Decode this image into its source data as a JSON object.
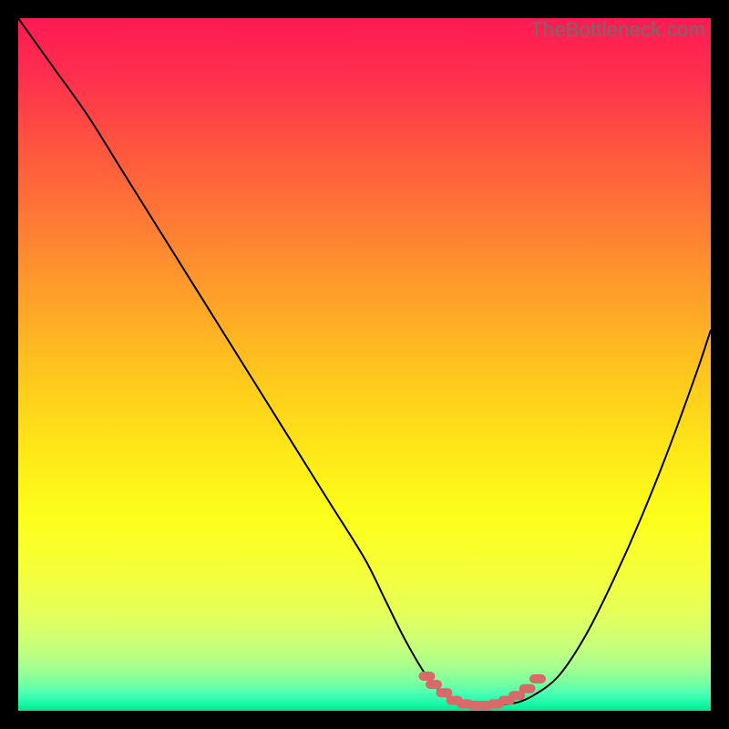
{
  "watermark": {
    "text": "TheBottleneck.com"
  },
  "colors": {
    "black": "#000000",
    "curve": "#000000",
    "marker": "#d96a6a",
    "gradient_stops": [
      {
        "offset": 0.0,
        "color": "#ff1a53"
      },
      {
        "offset": 0.08,
        "color": "#ff2e4e"
      },
      {
        "offset": 0.2,
        "color": "#ff5a3e"
      },
      {
        "offset": 0.35,
        "color": "#ff8e2f"
      },
      {
        "offset": 0.5,
        "color": "#ffc21e"
      },
      {
        "offset": 0.62,
        "color": "#ffe617"
      },
      {
        "offset": 0.72,
        "color": "#fcff1a"
      },
      {
        "offset": 0.8,
        "color": "#f5ff3a"
      },
      {
        "offset": 0.86,
        "color": "#e4ff5a"
      },
      {
        "offset": 0.905,
        "color": "#c8ff7a"
      },
      {
        "offset": 0.935,
        "color": "#a8ff8e"
      },
      {
        "offset": 0.958,
        "color": "#7cffa0"
      },
      {
        "offset": 0.975,
        "color": "#4affb2"
      },
      {
        "offset": 0.99,
        "color": "#18f7a8"
      },
      {
        "offset": 1.0,
        "color": "#00e887"
      }
    ]
  },
  "chart_data": {
    "type": "line",
    "title": "",
    "xlabel": "",
    "ylabel": "",
    "xlim": [
      0,
      100
    ],
    "ylim": [
      0,
      100
    ],
    "grid": false,
    "legend": false,
    "series": [
      {
        "name": "bottleneck-curve",
        "x": [
          0,
          5,
          10,
          15,
          20,
          25,
          30,
          35,
          40,
          45,
          50,
          53,
          56,
          59,
          62,
          65,
          68,
          71,
          74,
          78,
          82,
          86,
          90,
          94,
          98,
          100
        ],
        "y": [
          100,
          93,
          86,
          78,
          70,
          62,
          54,
          46,
          38,
          30,
          22,
          16,
          10,
          5,
          2,
          1,
          1,
          1,
          2,
          5,
          11,
          19,
          28,
          38,
          49,
          55
        ]
      }
    ],
    "markers": {
      "name": "optimal-range",
      "x": [
        59,
        60,
        61.5,
        63,
        64.5,
        66,
        67.5,
        69,
        70.5,
        72,
        73.5,
        75
      ],
      "y": [
        5,
        3.8,
        2.6,
        1.5,
        1,
        0.8,
        0.8,
        1,
        1.5,
        2.2,
        3.2,
        4.6
      ]
    }
  }
}
